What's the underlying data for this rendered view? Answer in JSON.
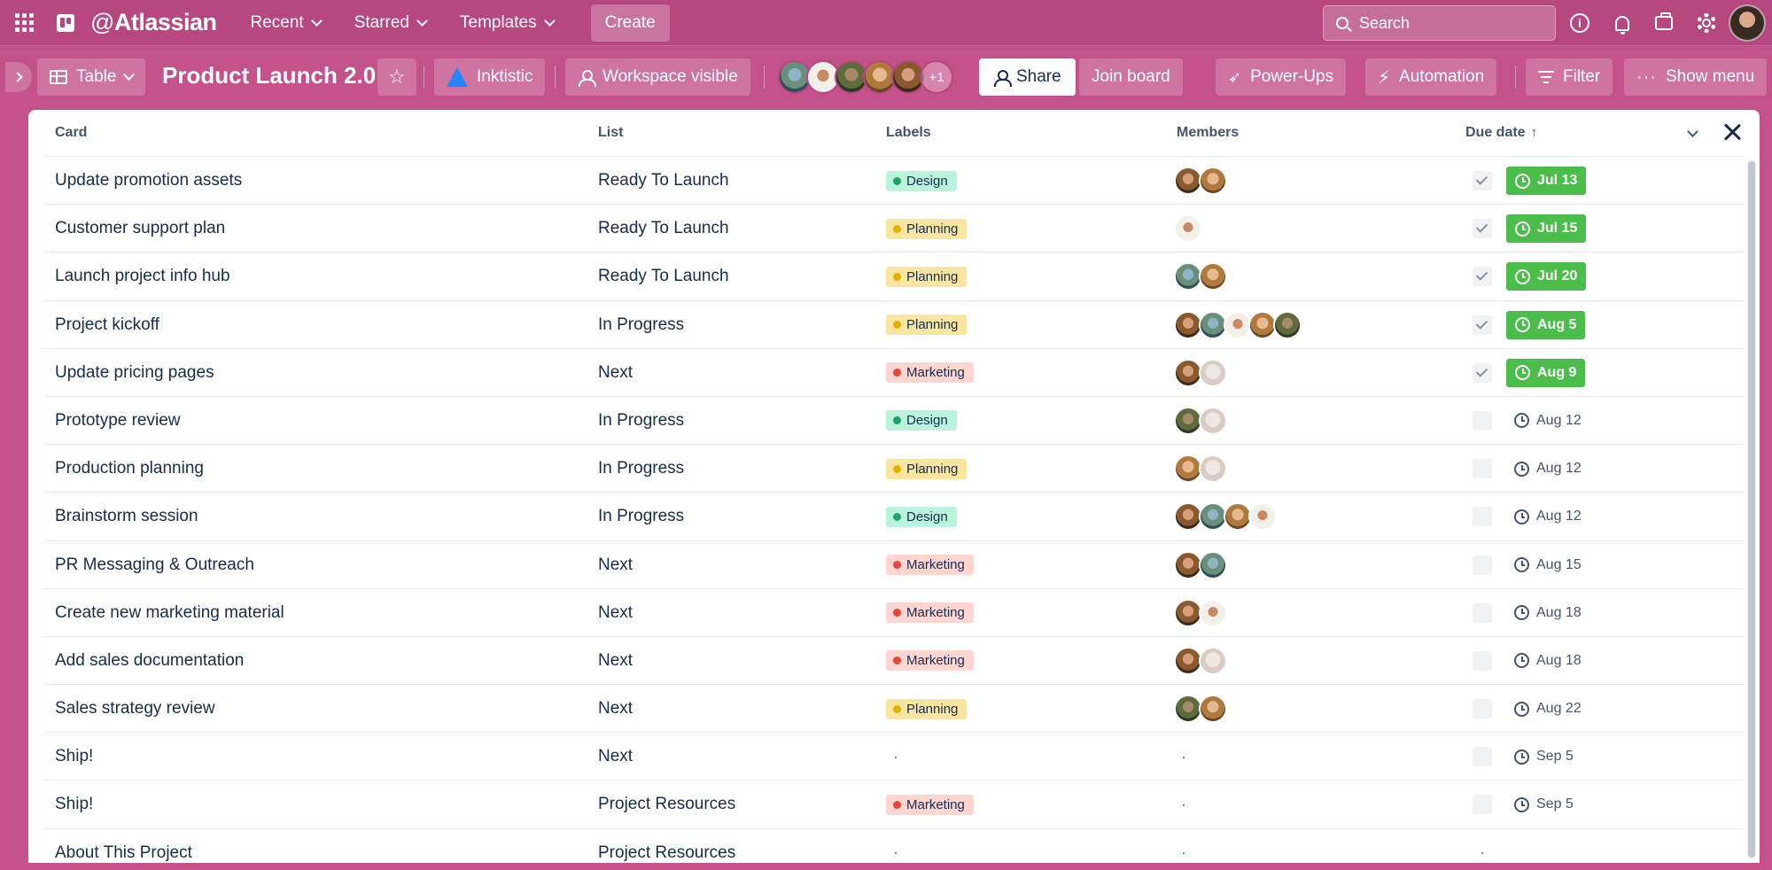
{
  "topnav": {
    "brand_at": "@",
    "brand_name": "Atlassian",
    "menus": [
      "Recent",
      "Starred",
      "Templates"
    ],
    "create_label": "Create",
    "search_placeholder": "Search"
  },
  "board": {
    "view_label": "Table",
    "title": "Product Launch 2.0",
    "workspace_label": "Inktistic",
    "visibility_label": "Workspace visible",
    "extra_members": "+1",
    "share_label": "Share",
    "join_label": "Join board",
    "powerups_label": "Power-Ups",
    "automation_label": "Automation",
    "filter_label": "Filter",
    "menu_label": "Show menu"
  },
  "table": {
    "columns": [
      "Card",
      "List",
      "Labels",
      "Members",
      "Due date"
    ],
    "sort_indicator": "↑",
    "empty_value": "·",
    "rows": [
      {
        "card": "Update promotion assets",
        "list": "Ready To Launch",
        "label": "Design",
        "members": [
          "a1",
          "a2"
        ],
        "due": "Jul 13",
        "done": true
      },
      {
        "card": "Customer support plan",
        "list": "Ready To Launch",
        "label": "Planning",
        "members": [
          "a3"
        ],
        "due": "Jul 15",
        "done": true
      },
      {
        "card": "Launch project info hub",
        "list": "Ready To Launch",
        "label": "Planning",
        "members": [
          "a4",
          "a2"
        ],
        "due": "Jul 20",
        "done": true
      },
      {
        "card": "Project kickoff",
        "list": "In Progress",
        "label": "Planning",
        "members": [
          "a1",
          "a4",
          "a3",
          "a2",
          "a5"
        ],
        "due": "Aug 5",
        "done": true
      },
      {
        "card": "Update pricing pages",
        "list": "Next",
        "label": "Marketing",
        "members": [
          "a1",
          "a6"
        ],
        "due": "Aug 9",
        "done": true
      },
      {
        "card": "Prototype review",
        "list": "In Progress",
        "label": "Design",
        "members": [
          "a5",
          "a6"
        ],
        "due": "Aug 12",
        "done": false
      },
      {
        "card": "Production planning",
        "list": "In Progress",
        "label": "Planning",
        "members": [
          "a2",
          "a6"
        ],
        "due": "Aug 12",
        "done": false
      },
      {
        "card": "Brainstorm session",
        "list": "In Progress",
        "label": "Design",
        "members": [
          "a1",
          "a4",
          "a2",
          "a3"
        ],
        "due": "Aug 12",
        "done": false
      },
      {
        "card": "PR Messaging & Outreach",
        "list": "Next",
        "label": "Marketing",
        "members": [
          "a1",
          "a4"
        ],
        "due": "Aug 15",
        "done": false
      },
      {
        "card": "Create new marketing material",
        "list": "Next",
        "label": "Marketing",
        "members": [
          "a1",
          "a3"
        ],
        "due": "Aug 18",
        "done": false
      },
      {
        "card": "Add sales documentation",
        "list": "Next",
        "label": "Marketing",
        "members": [
          "a1",
          "a6"
        ],
        "due": "Aug 18",
        "done": false
      },
      {
        "card": "Sales strategy review",
        "list": "Next",
        "label": "Planning",
        "members": [
          "a5",
          "a2"
        ],
        "due": "Aug 22",
        "done": false
      },
      {
        "card": "Ship!",
        "list": "Next",
        "label": "",
        "members": [],
        "due": "Sep 5",
        "done": false
      },
      {
        "card": "Ship!",
        "list": "Project Resources",
        "label": "Marketing",
        "members": [],
        "due": "Sep 5",
        "done": false
      },
      {
        "card": "About This Project",
        "list": "Project Resources",
        "label": "",
        "members": [],
        "due": "",
        "done": false
      }
    ]
  },
  "colors": {
    "nav_bg": "#b7477f",
    "board_bg": "#c4528a",
    "due_complete": "#4bbd4b",
    "label_design": "#baf3db",
    "label_planning": "#f8e6a0",
    "label_marketing": "#ffd5d2"
  }
}
